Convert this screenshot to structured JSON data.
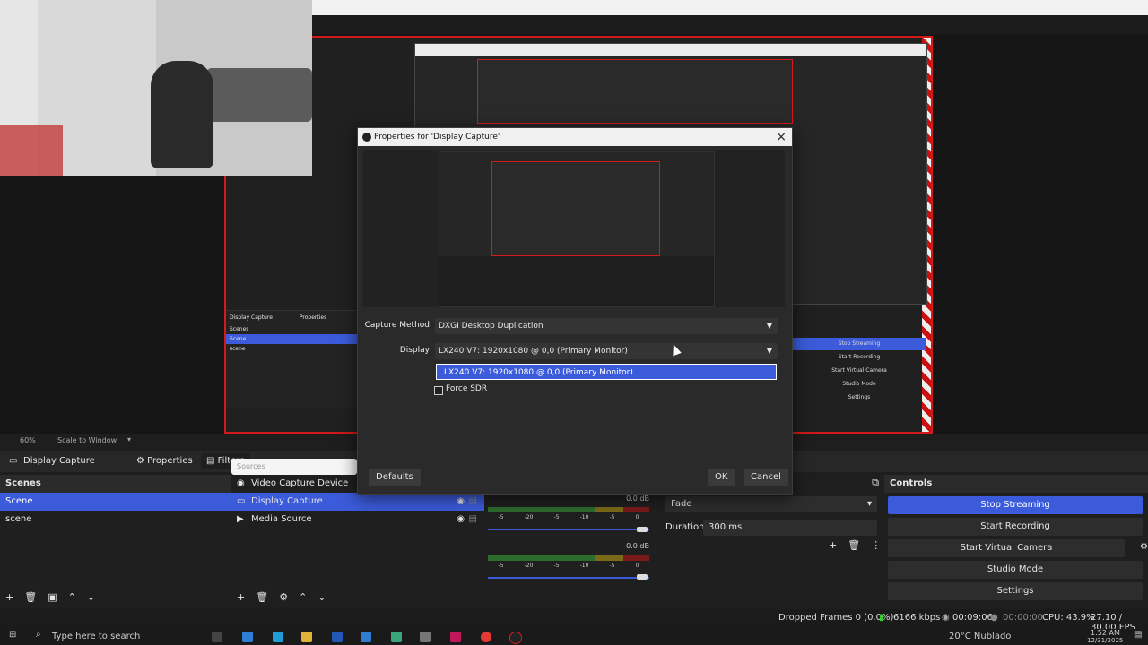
{
  "preview": {
    "zoom": "60%",
    "scale_mode": "Scale to Window",
    "inner_scene_label": "Display Capture",
    "inner_properties_label": "Properties",
    "inner_scenes_title": "Scenes",
    "inner_scenes": [
      "Scene",
      "scene"
    ],
    "inner_controls": [
      "Stop Streaming",
      "Start Recording",
      "Start Virtual Camera",
      "Studio Mode",
      "Settings"
    ]
  },
  "toolbar": {
    "source_label": "Display Capture",
    "properties_label": "Properties",
    "filters_label": "Filters",
    "sources_search": "Sources"
  },
  "scenes": {
    "title": "Scenes",
    "items": [
      "Scene",
      "scene"
    ]
  },
  "sources": {
    "items": [
      {
        "label": "Video Capture Device",
        "icon": "camera-icon"
      },
      {
        "label": "Display Capture",
        "icon": "monitor-icon"
      },
      {
        "label": "Media Source",
        "icon": "play-icon"
      }
    ]
  },
  "mixer": {
    "channel1_db": "0.0 dB",
    "channel2_db": "0.0 dB",
    "scale_ticks": [
      "-5",
      "-20",
      "-5",
      "-10",
      "-5",
      "0"
    ]
  },
  "transitions": {
    "type": "Fade",
    "duration_label": "Duration",
    "duration_value": "300 ms"
  },
  "controls": {
    "title": "Controls",
    "stop_streaming": "Stop Streaming",
    "start_recording": "Start Recording",
    "start_virtual_camera": "Start Virtual Camera",
    "studio_mode": "Studio Mode",
    "settings": "Settings"
  },
  "status": {
    "dropped_frames": "Dropped Frames 0 (0.0%)",
    "bitrate": "6166 kbps",
    "stream_time": "00:09:06",
    "rec_time": "00:00:00",
    "cpu": "CPU: 43.9%",
    "fps": "27.10 / 30.00 FPS"
  },
  "dialog": {
    "title": "Properties for 'Display Capture'",
    "capture_method_label": "Capture Method",
    "capture_method_value": "DXGI Desktop Duplication",
    "display_label": "Display",
    "display_value": "LX240 V7: 1920x1080 @ 0,0 (Primary Monitor)",
    "dropdown_option": "LX240 V7: 1920x1080 @ 0,0 (Primary Monitor)",
    "force_sdr_label": "Force SDR",
    "defaults_label": "Defaults",
    "ok_label": "OK",
    "cancel_label": "Cancel"
  },
  "taskbar": {
    "search_placeholder": "Type here to search",
    "weather": "20°C  Nublado",
    "time": "1:52 AM",
    "date": "12/31/2025"
  },
  "colors": {
    "accent": "#3b5bdb",
    "capture_border": "#d11a1a"
  }
}
